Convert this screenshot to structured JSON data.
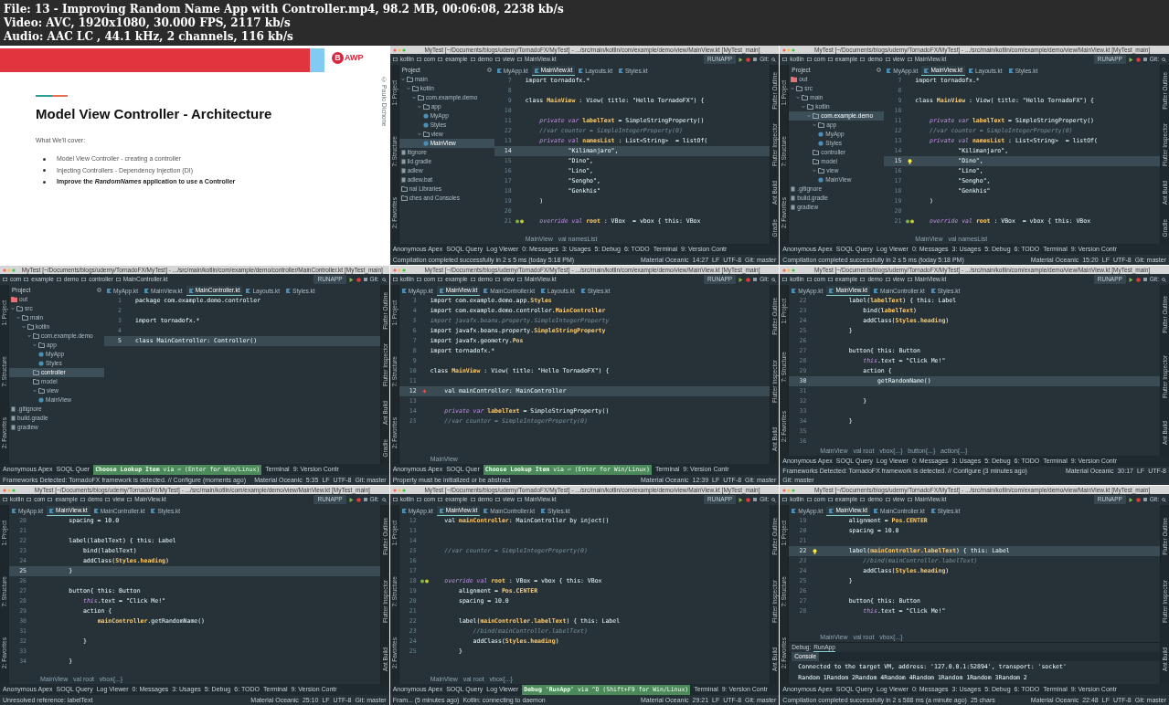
{
  "header": [
    "File: 13 - Improving Random Name App with Controller.mp4, 98.2 MB, 00:06:08, 2238 kb/s",
    "Video: AVC, 1920x1080, 30.000 FPS, 2117 kb/s",
    "Audio: AAC LC , 44.1 kHz, 2 channels, 116 kb/s"
  ],
  "panels": [
    {
      "kind": "slide",
      "logo_letter": "B",
      "logo_text": "AWP",
      "copyright": "© Paulo Dichone",
      "title": "Model View Controller - Architecture",
      "intro": "What We'll cover:",
      "bullets": [
        {
          "text": "Model View Controller - creating a controller",
          "bold": false
        },
        {
          "text": "Injecting Controllers - Dependency Injection (DI)",
          "bold": false
        },
        {
          "text": "Improve the *RandomNames* application to use a Controller",
          "bold": true
        }
      ]
    },
    {
      "kind": "ide",
      "title": "MyTest [~/Documents/blogs/udemy/TornadoFX/MyTest] - .../src/main/kotlin/com/example/demo/view/MainView.kt [MyTest_main]",
      "breadcrumbs": [
        "kotlin",
        "com",
        "example",
        "demo",
        "view",
        "MainView.kt"
      ],
      "run_config": "RUNAPP",
      "git": "Git:",
      "left_strip": [
        "1: Project",
        "7: Structure",
        "2: Favorites"
      ],
      "right_strip": [
        "Flutter Outline",
        "Flutter Inspector",
        "Ant Build",
        "Gradle"
      ],
      "project_label": "Project",
      "tree": [
        {
          "label": "main",
          "kind": "folder",
          "selected": false,
          "children": [
            {
              "label": "kotlin",
              "kind": "folder",
              "selected": false,
              "children": [
                {
                  "label": "com.example.demo",
                  "kind": "folder",
                  "selected": false,
                  "children": [
                    {
                      "label": "app",
                      "kind": "folder",
                      "selected": false,
                      "children": [
                        {
                          "label": "MyApp",
                          "kind": "class",
                          "selected": false
                        },
                        {
                          "label": "Styles",
                          "kind": "class",
                          "selected": false
                        }
                      ]
                    },
                    {
                      "label": "view",
                      "kind": "folder",
                      "selected": false,
                      "children": [
                        {
                          "label": "MainView",
                          "kind": "class",
                          "selected": true
                        }
                      ]
                    }
                  ]
                }
              ]
            }
          ]
        },
        {
          "label": "itignore",
          "kind": "file",
          "selected": false
        },
        {
          "label": "ild.gradle",
          "kind": "file",
          "selected": false
        },
        {
          "label": "adlew",
          "kind": "file",
          "selected": false
        },
        {
          "label": "adlew.bat",
          "kind": "file",
          "selected": false
        },
        {
          "label": "nal Libraries",
          "kind": "folder",
          "selected": false
        },
        {
          "label": "ches and Consoles",
          "kind": "folder",
          "selected": false
        }
      ],
      "tabs": [
        {
          "label": "MyApp.kt",
          "selected": false
        },
        {
          "label": "MainView.kt",
          "selected": true
        },
        {
          "label": "Layouts.kt",
          "selected": false
        },
        {
          "label": "Styles.kt",
          "selected": false
        }
      ],
      "lines": [
        {
          "num": "7",
          "text": "import tornadofx.*",
          "kind": "code",
          "current": false
        },
        {
          "num": "8",
          "kind": "code",
          "current": false
        },
        {
          "num": "9",
          "text": "class **MainView** : View( title: \"Hello TornadoFX\") {",
          "kind": "code",
          "current": false
        },
        {
          "num": "10",
          "kind": "code",
          "current": false
        },
        {
          "num": "11",
          "text": "    *private var* **labelText** = SimpleStringProperty()",
          "kind": "code",
          "current": false
        },
        {
          "num": "12",
          "text": "    //var counter = SimpleIntegerProperty(0)",
          "kind": "comment",
          "current": false
        },
        {
          "num": "13",
          "text": "    *private val* **namesList** : List<String>  = listOf(",
          "kind": "code",
          "current": false
        },
        {
          "num": "14",
          "text": "            \"Kilimanjaro\",",
          "kind": "code",
          "current": true
        },
        {
          "num": "15",
          "text": "            \"Dino\",",
          "kind": "code",
          "current": false
        },
        {
          "num": "16",
          "text": "            \"Lino\",",
          "kind": "code",
          "current": false
        },
        {
          "num": "17",
          "text": "            \"Sengho\",",
          "kind": "code",
          "current": false
        },
        {
          "num": "18",
          "text": "            \"Genkhis\"",
          "kind": "code",
          "current": false
        },
        {
          "num": "19",
          "text": "    )",
          "kind": "code",
          "current": false
        },
        {
          "num": "20",
          "kind": "code",
          "current": false
        },
        {
          "num": "21",
          "text": "    *override val* **root** : VBox  = vbox { this: VBox",
          "kind": "code",
          "current": false,
          "marker": {
            "kind": "run"
          }
        }
      ],
      "code_crumb": "MainView   val namesList",
      "tool_row": [
        {
          "kind": "tab",
          "label": "Anonymous Apex"
        },
        {
          "kind": "tab",
          "label": "SOQL Query"
        },
        {
          "kind": "tab",
          "label": "Log Viewer"
        },
        {
          "kind": "tab",
          "label": "0: Messages"
        },
        {
          "kind": "tab",
          "label": "3: Usages"
        },
        {
          "kind": "tab",
          "label": "5: Debug"
        },
        {
          "kind": "tab",
          "label": "6: TODO"
        },
        {
          "kind": "tab",
          "label": "Terminal"
        },
        {
          "kind": "tab",
          "label": "9: Version Contr"
        }
      ],
      "status": "Compilation completed successfully in 2 s 5 ms (today 5:18 PM)",
      "status_right": [
        "Material Oceanic",
        "14:27",
        "LF",
        "UTF-8",
        "Git: master"
      ]
    },
    {
      "kind": "ide",
      "title": "MyTest [~/Documents/blogs/udemy/TornadoFX/MyTest] - .../src/main/kotlin/com/example/demo/view/MainView.kt [MyTest_main]",
      "breadcrumbs": [
        "kotlin",
        "com",
        "example",
        "demo",
        "view",
        "MainView.kt"
      ],
      "run_config": "RUNAPP",
      "git": "Git:",
      "left_strip": [
        "1: Project",
        "7: Structure",
        "2: Favorites"
      ],
      "right_strip": [
        "Flutter Outline",
        "Flutter Inspector",
        "Ant Build",
        "Gradle"
      ],
      "project_label": "Project",
      "tree": [
        {
          "label": "out",
          "kind": "excluded",
          "selected": false
        },
        {
          "label": "src",
          "kind": "folder",
          "selected": false,
          "children": [
            {
              "label": "main",
              "kind": "folder",
              "selected": false,
              "children": [
                {
                  "label": "kotlin",
                  "kind": "folder",
                  "selected": false,
                  "children": [
                    {
                      "label": "com.example.demo",
                      "kind": "folder",
                      "selected": true,
                      "children": [
                        {
                          "label": "app",
                          "kind": "folder",
                          "selected": false,
                          "children": [
                            {
                              "label": "MyApp",
                              "kind": "class",
                              "selected": false
                            },
                            {
                              "label": "Styles",
                              "kind": "class",
                              "selected": false
                            }
                          ]
                        },
                        {
                          "label": "controller",
                          "kind": "folder",
                          "selected": false
                        },
                        {
                          "label": "model",
                          "kind": "folder",
                          "selected": false
                        },
                        {
                          "label": "view",
                          "kind": "folder",
                          "selected": false,
                          "children": [
                            {
                              "label": "MainView",
                              "kind": "class",
                              "selected": false
                            }
                          ]
                        }
                      ]
                    }
                  ]
                }
              ]
            }
          ]
        },
        {
          "label": ".gitignore",
          "kind": "file",
          "selected": false
        },
        {
          "label": "build.gradle",
          "kind": "file",
          "selected": false
        },
        {
          "label": "gradlew",
          "kind": "file",
          "selected": false
        }
      ],
      "tabs": [
        {
          "label": "MyApp.kt",
          "selected": false
        },
        {
          "label": "MainView.kt",
          "selected": true
        },
        {
          "label": "Layouts.kt",
          "selected": false
        },
        {
          "label": "Styles.kt",
          "selected": false
        }
      ],
      "lines": [
        {
          "num": "7",
          "text": "import tornadofx.*",
          "kind": "code",
          "current": false
        },
        {
          "num": "8",
          "kind": "code",
          "current": false
        },
        {
          "num": "9",
          "text": "class **MainView** : View( title: \"Hello TornadoFX\") {",
          "kind": "code",
          "current": false
        },
        {
          "num": "10",
          "kind": "code",
          "current": false
        },
        {
          "num": "11",
          "text": "    *private var* **labelText** = SimpleStringProperty()",
          "kind": "code",
          "current": false
        },
        {
          "num": "12",
          "text": "    //var counter = SimpleIntegerProperty(0)",
          "kind": "comment",
          "current": false
        },
        {
          "num": "13",
          "text": "    *private val* **namesList** : List<String>  = listOf(",
          "kind": "code",
          "current": false
        },
        {
          "num": "14",
          "text": "            \"Kilimanjaro\",",
          "kind": "code",
          "current": false
        },
        {
          "num": "15",
          "text": "            \"Dino\",",
          "kind": "code",
          "current": true,
          "marker": {
            "kind": "bulb"
          }
        },
        {
          "num": "16",
          "text": "            \"Lino\",",
          "kind": "code",
          "current": false
        },
        {
          "num": "17",
          "text": "            \"Sengho\",",
          "kind": "code",
          "current": false
        },
        {
          "num": "18",
          "text": "            \"Genkhis\"",
          "kind": "code",
          "current": false
        },
        {
          "num": "19",
          "text": "    )",
          "kind": "code",
          "current": false
        },
        {
          "num": "20",
          "kind": "code",
          "current": false
        },
        {
          "num": "21",
          "text": "    *override val* **root** : VBox  = vbox { this: VBox",
          "kind": "code",
          "current": false,
          "marker": {
            "kind": "run"
          }
        }
      ],
      "code_crumb": "MainView   val namesList",
      "tool_row": [
        {
          "kind": "tab",
          "label": "Anonymous Apex"
        },
        {
          "kind": "tab",
          "label": "SOQL Query"
        },
        {
          "kind": "tab",
          "label": "Log Viewer"
        },
        {
          "kind": "tab",
          "label": "0: Messages"
        },
        {
          "kind": "tab",
          "label": "3: Usages"
        },
        {
          "kind": "tab",
          "label": "5: Debug"
        },
        {
          "kind": "tab",
          "label": "6: TODO"
        },
        {
          "kind": "tab",
          "label": "Terminal"
        },
        {
          "kind": "tab",
          "label": "9: Version Contr"
        }
      ],
      "status": "Compilation completed successfully in 2 s 5 ms (today 5:18 PM)",
      "status_right": [
        "Material Oceanic",
        "15:20",
        "LF",
        "UTF-8",
        "Git: master"
      ]
    },
    {
      "kind": "ide",
      "title": "MyTest [~/Documents/blogs/udemy/TornadoFX/MyTest] - .../src/main/kotlin/com/example/demo/controller/MainController.kt [MyTest_main]",
      "breadcrumbs": [
        "com",
        "example",
        "demo",
        "controller",
        "MainController.kt"
      ],
      "run_config": "RUNAPP",
      "git": "Git:",
      "left_strip": [
        "1: Project",
        "7: Structure",
        "2: Favorites"
      ],
      "right_strip": [
        "Flutter Outline",
        "Flutter Inspector",
        "Ant Build",
        "Gradle"
      ],
      "project_label": "Project",
      "tree": [
        {
          "label": "out",
          "kind": "excluded",
          "selected": false
        },
        {
          "label": "src",
          "kind": "folder",
          "selected": false,
          "children": [
            {
              "label": "main",
              "kind": "folder",
              "selected": false,
              "children": [
                {
                  "label": "kotlin",
                  "kind": "folder",
                  "selected": false,
                  "children": [
                    {
                      "label": "com.example.demo",
                      "kind": "folder",
                      "selected": false,
                      "children": [
                        {
                          "label": "app",
                          "kind": "folder",
                          "selected": false,
                          "children": [
                            {
                              "label": "MyApp",
                              "kind": "class",
                              "selected": false
                            },
                            {
                              "label": "Styles",
                              "kind": "class",
                              "selected": false
                            }
                          ]
                        },
                        {
                          "label": "controller",
                          "kind": "folder",
                          "selected": true
                        },
                        {
                          "label": "model",
                          "kind": "folder",
                          "selected": false
                        },
                        {
                          "label": "view",
                          "kind": "folder",
                          "selected": false,
                          "children": [
                            {
                              "label": "MainView",
                              "kind": "class",
                              "selected": false
                            }
                          ]
                        }
                      ]
                    }
                  ]
                }
              ]
            }
          ]
        },
        {
          "label": ".gitignore",
          "kind": "file",
          "selected": false
        },
        {
          "label": "build.gradle",
          "kind": "file",
          "selected": false
        },
        {
          "label": "gradlew",
          "kind": "file",
          "selected": false
        }
      ],
      "tabs": [
        {
          "label": "MyApp.kt",
          "selected": false
        },
        {
          "label": "MainView.kt",
          "selected": false
        },
        {
          "label": "MainController.kt",
          "selected": true
        },
        {
          "label": "Layouts.kt",
          "selected": false
        },
        {
          "label": "Styles.kt",
          "selected": false
        }
      ],
      "lines": [
        {
          "num": "1",
          "text": "package com.example.demo.controller",
          "kind": "code",
          "current": false
        },
        {
          "num": "2",
          "kind": "code",
          "current": false
        },
        {
          "num": "3",
          "text": "import tornadofx.*",
          "kind": "code",
          "current": false
        },
        {
          "num": "4",
          "kind": "code",
          "current": false
        },
        {
          "num": "5",
          "text": "class MainController: Controller()",
          "kind": "code",
          "current": true
        }
      ],
      "tool_row": [
        {
          "kind": "tab",
          "label": "Anonymous Apex"
        },
        {
          "kind": "tab",
          "label": "SOQL Quer"
        },
        {
          "kind": "hint",
          "label": "**Choose Lookup Item** via ⏎ (Enter for Win/Linux)"
        },
        {
          "kind": "tab",
          "label": "Terminal"
        },
        {
          "kind": "tab",
          "label": "9: Version Contr"
        }
      ],
      "status": "Frameworks Detected: TornadoFX framework is detected. // Configure (moments ago)",
      "status_right": [
        "Material Oceanic",
        "5:35",
        "LF",
        "UTF-8",
        "Git: master"
      ]
    },
    {
      "kind": "ide",
      "title": "MyTest [~/Documents/blogs/udemy/TornadoFX/MyTest] - .../src/main/kotlin/com/example/demo/view/MainView.kt [MyTest_main]",
      "breadcrumbs": [
        "kotlin",
        "com",
        "example",
        "demo",
        "view",
        "MainView.kt"
      ],
      "run_config": "RUNAPP",
      "git": "Git:",
      "left_strip": [
        "1: Project",
        "7: Structure",
        "2: Favorites"
      ],
      "right_strip": [
        "Flutter Outline",
        "Flutter Inspector",
        "Ant Build"
      ],
      "tabs": [
        {
          "label": "MyApp.kt",
          "selected": false
        },
        {
          "label": "MainView.kt",
          "selected": true
        },
        {
          "label": "MainController.kt",
          "selected": false
        },
        {
          "label": "Layouts.kt",
          "selected": false
        },
        {
          "label": "Styles.kt",
          "selected": false
        }
      ],
      "lines": [
        {
          "num": "3",
          "text": "import com.example.demo.app.**Styles**",
          "kind": "code",
          "current": false
        },
        {
          "num": "4",
          "text": "import com.example.demo.controller.**MainController**",
          "kind": "code",
          "current": false
        },
        {
          "num": "5",
          "text": "import javafx.beans.property.SimpleIntegerProperty",
          "kind": "comment",
          "current": false
        },
        {
          "num": "6",
          "text": "import javafx.beans.property.**SimpleStringProperty**",
          "kind": "code",
          "current": false
        },
        {
          "num": "7",
          "text": "import javafx.geometry.**Pos**",
          "kind": "code",
          "current": false
        },
        {
          "num": "8",
          "text": "import tornadofx.*",
          "kind": "code",
          "current": false
        },
        {
          "num": "9",
          "kind": "code",
          "current": false
        },
        {
          "num": "10",
          "text": "class **MainView** : View( title: \"Hello TornadoFX\") {",
          "kind": "code",
          "current": false
        },
        {
          "num": "11",
          "kind": "code",
          "current": false
        },
        {
          "num": "12",
          "text": "    val mainController: MainController",
          "kind": "code",
          "current": true,
          "marker": {
            "kind": "error"
          }
        },
        {
          "num": "13",
          "kind": "code",
          "current": false
        },
        {
          "num": "14",
          "text": "    *private var* **labelText** = SimpleStringProperty()",
          "kind": "code",
          "current": false
        },
        {
          "num": "15",
          "text": "    //var counter = SimpleIntegerProperty(0)",
          "kind": "comment",
          "current": false
        }
      ],
      "code_crumb": "MainView",
      "tool_row": [
        {
          "kind": "tab",
          "label": "Anonymous Apex"
        },
        {
          "kind": "tab",
          "label": "SOQL Quer"
        },
        {
          "kind": "hint",
          "label": "**Choose Lookup Item** via ⏎ (Enter for Win/Linux)"
        },
        {
          "kind": "tab",
          "label": "Terminal"
        },
        {
          "kind": "tab",
          "label": "9: Version Contr"
        }
      ],
      "status": "Property must be initialized or be abstract",
      "status_right": [
        "Material Oceanic",
        "12:39",
        "LF",
        "UTF-8",
        "Git: master"
      ]
    },
    {
      "kind": "ide",
      "title": "MyTest [~/Documents/blogs/udemy/TornadoFX/MyTest] - .../src/main/kotlin/com/example/demo/view/MainView.kt [MyTest_main]",
      "breadcrumbs": [
        "kotlin",
        "com",
        "example",
        "demo",
        "view",
        "MainView.kt"
      ],
      "run_config": "RUNAPP",
      "git": "Git:",
      "left_strip": [
        "1: Project",
        "7: Structure",
        "2: Favorites"
      ],
      "right_strip": [
        "Flutter Outline",
        "Flutter Inspector",
        "Ant Build"
      ],
      "tabs": [
        {
          "label": "MyApp.kt",
          "selected": false
        },
        {
          "label": "MainView.kt",
          "selected": true
        },
        {
          "label": "MainController.kt",
          "selected": false
        },
        {
          "label": "Styles.kt",
          "selected": false
        }
      ],
      "lines": [
        {
          "num": "22",
          "text": "        label(**labelText**) { this: Label",
          "kind": "code",
          "current": false
        },
        {
          "num": "23",
          "text": "            bind(**labelText**)",
          "kind": "code",
          "current": false
        },
        {
          "num": "24",
          "text": "            addClass(**Styles**.**heading**)",
          "kind": "code",
          "current": false
        },
        {
          "num": "25",
          "text": "        }",
          "kind": "code",
          "current": false
        },
        {
          "num": "26",
          "kind": "code",
          "current": false
        },
        {
          "num": "27",
          "text": "        button{ this: Button",
          "kind": "code",
          "current": false
        },
        {
          "num": "28",
          "text": "            *this*.text = \"Click Me!\"",
          "kind": "code",
          "current": false
        },
        {
          "num": "29",
          "text": "            action {",
          "kind": "code",
          "current": false
        },
        {
          "num": "30",
          "text": "                getRandomName()",
          "kind": "code",
          "current": true
        },
        {
          "num": "31",
          "kind": "code",
          "current": false
        },
        {
          "num": "32",
          "text": "            }",
          "kind": "code",
          "current": false
        },
        {
          "num": "33",
          "kind": "code",
          "current": false
        },
        {
          "num": "34",
          "text": "        }",
          "kind": "code",
          "current": false
        },
        {
          "num": "35",
          "kind": "code",
          "current": false
        },
        {
          "num": "36",
          "kind": "code",
          "current": false
        }
      ],
      "code_crumb": "MainView   val root   vbox{...}   button{...}   action{...}",
      "tool_row": [
        {
          "kind": "tab",
          "label": "Anonymous Apex"
        },
        {
          "kind": "tab",
          "label": "SOQL Query"
        },
        {
          "kind": "tab",
          "label": "Log Viewer"
        },
        {
          "kind": "tab",
          "label": "0: Messages"
        },
        {
          "kind": "tab",
          "label": "3: Usages"
        },
        {
          "kind": "tab",
          "label": "5: Debug"
        },
        {
          "kind": "tab",
          "label": "6: TODO"
        },
        {
          "kind": "tab",
          "label": "Terminal"
        },
        {
          "kind": "tab",
          "label": "9: Version Contr"
        }
      ],
      "status": "Frameworks Detected: TornadoFX framework is detected. // Configure (3 minutes ago)",
      "status_right": [
        "Material Oceanic",
        "30:17",
        "LF",
        "UTF-8",
        "Git: master"
      ]
    },
    {
      "kind": "ide",
      "title": "MyTest [~/Documents/blogs/udemy/TornadoFX/MyTest] - .../src/main/kotlin/com/example/demo/view/MainView.kt [MyTest_main]",
      "breadcrumbs": [
        "kotlin",
        "com",
        "example",
        "demo",
        "view",
        "MainView.kt"
      ],
      "run_config": "RUNAPP",
      "git": "Git:",
      "left_strip": [
        "1: Project",
        "7: Structure",
        "2: Favorites"
      ],
      "right_strip": [
        "Flutter Outline",
        "Flutter Inspector",
        "Ant Build"
      ],
      "tabs": [
        {
          "label": "MyApp.kt",
          "selected": false
        },
        {
          "label": "MainView.kt",
          "selected": true
        },
        {
          "label": "MainController.kt",
          "selected": false
        },
        {
          "label": "Styles.kt",
          "selected": false
        }
      ],
      "lines": [
        {
          "num": "20",
          "text": "        spacing = 10.0",
          "kind": "code",
          "current": false
        },
        {
          "num": "21",
          "kind": "code",
          "current": false
        },
        {
          "num": "22",
          "text": "        label(labelText) { this: Label",
          "kind": "code",
          "current": false
        },
        {
          "num": "23",
          "text": "            bind(labelText)",
          "kind": "code",
          "current": false
        },
        {
          "num": "24",
          "text": "            addClass(**Styles**.**heading**)",
          "kind": "code",
          "current": false
        },
        {
          "num": "25",
          "text": "        }",
          "kind": "code",
          "current": true
        },
        {
          "num": "26",
          "kind": "code",
          "current": false
        },
        {
          "num": "27",
          "text": "        button{ this: Button",
          "kind": "code",
          "current": false
        },
        {
          "num": "28",
          "text": "            *this*.text = \"Click Me!\"",
          "kind": "code",
          "current": false
        },
        {
          "num": "29",
          "text": "            action {",
          "kind": "code",
          "current": false
        },
        {
          "num": "30",
          "text": "                **mainController**.getRandomName()",
          "kind": "code",
          "current": false
        },
        {
          "num": "31",
          "kind": "code",
          "current": false
        },
        {
          "num": "32",
          "text": "            }",
          "kind": "code",
          "current": false
        },
        {
          "num": "33",
          "kind": "code",
          "current": false
        },
        {
          "num": "34",
          "text": "        }",
          "kind": "code",
          "current": false
        }
      ],
      "code_crumb": "MainView   val root   vbox{...}",
      "tool_row": [
        {
          "kind": "tab",
          "label": "Anonymous Apex"
        },
        {
          "kind": "tab",
          "label": "SOQL Query"
        },
        {
          "kind": "tab",
          "label": "Log Viewer"
        },
        {
          "kind": "tab",
          "label": "0: Messages"
        },
        {
          "kind": "tab",
          "label": "3: Usages"
        },
        {
          "kind": "tab",
          "label": "5: Debug"
        },
        {
          "kind": "tab",
          "label": "6: TODO"
        },
        {
          "kind": "tab",
          "label": "Terminal"
        },
        {
          "kind": "tab",
          "label": "9: Version Contr"
        }
      ],
      "status": "Unresolved reference: labelText",
      "status_right": [
        "Material Oceanic",
        "25:10",
        "LF",
        "UTF-8",
        "Git: master"
      ]
    },
    {
      "kind": "ide",
      "title": "MyTest [~/Documents/blogs/udemy/TornadoFX/MyTest] - .../src/main/kotlin/com/example/demo/view/MainView.kt [MyTest_main]",
      "breadcrumbs": [
        "kotlin",
        "com",
        "example",
        "demo",
        "view",
        "MainView.kt"
      ],
      "run_config": "RUNAPP",
      "git": "Git:",
      "left_strip": [
        "1: Project",
        "7: Structure",
        "2: Favorites"
      ],
      "right_strip": [
        "Flutter Outline",
        "Flutter Inspector",
        "Ant Build"
      ],
      "tabs": [
        {
          "label": "MyApp.kt",
          "selected": false
        },
        {
          "label": "MainView.kt",
          "selected": true
        },
        {
          "label": "MainController.kt",
          "selected": false
        },
        {
          "label": "Styles.kt",
          "selected": false
        }
      ],
      "lines": [
        {
          "num": "12",
          "text": "    val **mainController**: MainController by inject()",
          "kind": "code",
          "current": false
        },
        {
          "num": "13",
          "kind": "code",
          "current": false
        },
        {
          "num": "14",
          "kind": "code",
          "current": false
        },
        {
          "num": "15",
          "text": "    //var counter = SimpleIntegerProperty(0)",
          "kind": "comment",
          "current": false
        },
        {
          "num": "16",
          "kind": "code",
          "current": false
        },
        {
          "num": "17",
          "kind": "code",
          "current": false
        },
        {
          "num": "18",
          "text": "    *override val* **root** : VBox = vbox { this: VBox",
          "kind": "code",
          "current": false,
          "marker": {
            "kind": "run"
          }
        },
        {
          "num": "19",
          "text": "        alignment = **Pos**.**CENTER**",
          "kind": "code",
          "current": false
        },
        {
          "num": "20",
          "text": "        spacing = 10.0",
          "kind": "code",
          "current": false
        },
        {
          "num": "21",
          "kind": "code",
          "current": false
        },
        {
          "num": "22",
          "text": "        label(**mainController**.**labelText**) { this: Label",
          "kind": "code",
          "current": false
        },
        {
          "num": "23",
          "text": "            //bind(mainController.labelText)",
          "kind": "comment",
          "current": false
        },
        {
          "num": "24",
          "text": "            addClass(**Styles**.**heading**)",
          "kind": "code",
          "current": false
        },
        {
          "num": "25",
          "text": "        }",
          "kind": "code",
          "current": false
        }
      ],
      "code_crumb": "MainView   val root   vbox{...}",
      "tool_row": [
        {
          "kind": "tab",
          "label": "Anonymous Apex"
        },
        {
          "kind": "tab",
          "label": "SOQL Query"
        },
        {
          "kind": "tab",
          "label": "Log Viewer"
        },
        {
          "kind": "hint",
          "label": "**Debug 'RunApp'** via ^D (Shift+F9 for Win/Linux)"
        },
        {
          "kind": "tab",
          "label": "Terminal"
        },
        {
          "kind": "tab",
          "label": "9: Version Contr"
        }
      ],
      "status": "Fram... (5 minutes ago)",
      "status_extra": "Kotlin: connecting to daemon",
      "status_right": [
        "Material Oceanic",
        "29:21",
        "LF",
        "UTF-8",
        "Git: master"
      ]
    },
    {
      "kind": "ide",
      "title": "MyTest [~/Documents/blogs/udemy/TornadoFX/MyTest] - .../src/main/kotlin/com/example/demo/view/MainView.kt [MyTest_main]",
      "breadcrumbs": [
        "kotlin",
        "com",
        "example",
        "demo",
        "view",
        "MainView.kt"
      ],
      "run_config": "RUNAPP",
      "git": "Git:",
      "left_strip": [
        "1: Project",
        "7: Structure",
        "2: Favorites"
      ],
      "right_strip": [
        "Flutter Outline",
        "Flutter Inspector",
        "Ant Build"
      ],
      "tabs": [
        {
          "label": "MyApp.kt",
          "selected": false
        },
        {
          "label": "MainView.kt",
          "selected": true
        },
        {
          "label": "MainController.kt",
          "selected": false
        },
        {
          "label": "Styles.kt",
          "selected": false
        }
      ],
      "lines": [
        {
          "num": "19",
          "text": "        alignment = **Pos**.**CENTER**",
          "kind": "code",
          "current": false
        },
        {
          "num": "20",
          "text": "        spacing = 10.0",
          "kind": "code",
          "current": false
        },
        {
          "num": "21",
          "kind": "code",
          "current": false
        },
        {
          "num": "22",
          "text": "        label(**mainController.labelText**) { this: Label",
          "kind": "code",
          "current": true,
          "marker": {
            "kind": "bulb"
          }
        },
        {
          "num": "23",
          "text": "            //bind(mainController.labelText)",
          "kind": "comment",
          "current": false
        },
        {
          "num": "24",
          "text": "            addClass(**Styles**.**heading**)",
          "kind": "code",
          "current": false
        },
        {
          "num": "25",
          "text": "        }",
          "kind": "code",
          "current": false
        },
        {
          "num": "26",
          "kind": "code",
          "current": false
        },
        {
          "num": "27",
          "text": "        button{ this: Button",
          "kind": "code",
          "current": false
        },
        {
          "num": "28",
          "text": "            *this*.text = \"Click Me!\"",
          "kind": "code",
          "current": false
        }
      ],
      "code_crumb": "MainView   val root   vbox{...}",
      "console": {
        "label": "Debug:",
        "session": "RunApp",
        "tab": "Console",
        "lines": [
          "Connected to the target VM, address: '127.0.0.1:52894', transport: 'socket'",
          "Random 1Random 2Random 4Random 4Random 1Random 1Random 3Random 2"
        ]
      },
      "tool_row": [
        {
          "kind": "tab",
          "label": "Anonymous Apex"
        },
        {
          "kind": "tab",
          "label": "SOQL Query"
        },
        {
          "kind": "tab",
          "label": "Log Viewer"
        },
        {
          "kind": "tab",
          "label": "0: Messages"
        },
        {
          "kind": "tab",
          "label": "3: Usages"
        },
        {
          "kind": "tab",
          "label": "5: Debug"
        },
        {
          "kind": "tab",
          "label": "6: TODO"
        },
        {
          "kind": "tab",
          "label": "Terminal"
        },
        {
          "kind": "tab",
          "label": "9: Version Contr"
        }
      ],
      "status": "Compilation completed successfully in 2 s 588 ms (a minute ago)",
      "status_extra": "25 chars",
      "status_right": [
        "Material Oceanic",
        "22:48",
        "LF",
        "UTF-8",
        "Git: master"
      ]
    }
  ]
}
